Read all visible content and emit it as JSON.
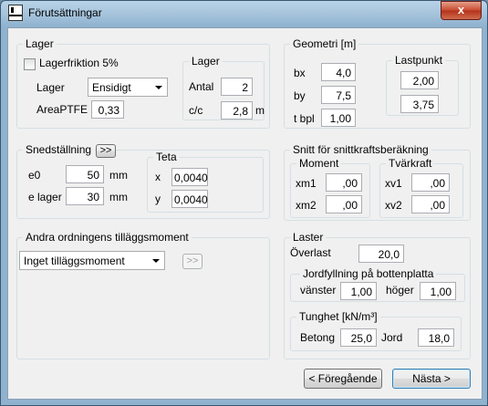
{
  "window": {
    "title": "Förutsättningar",
    "close_label": "x"
  },
  "lager": {
    "title": "Lager",
    "friction_label": "Lagerfriktion 5%",
    "friction_checked": false,
    "type_label": "Lager",
    "type_value": "Ensidigt",
    "area_label": "AreaPTFE",
    "area_value": "0,33",
    "sub": {
      "title": "Lager",
      "antal_label": "Antal",
      "antal_value": "2",
      "cc_label": "c/c",
      "cc_value": "2,8",
      "cc_unit": "m"
    }
  },
  "geometri": {
    "title": "Geometri [m]",
    "bx_label": "bx",
    "bx_value": "4,0",
    "by_label": "by",
    "by_value": "7,5",
    "tbpl_label": "t bpl",
    "tbpl_value": "1,00",
    "lastpunkt": {
      "title": "Lastpunkt",
      "v1": "2,00",
      "v2": "3,75"
    }
  },
  "sned": {
    "title": "Snedställning",
    "button_label": ">>",
    "e0_label": "e0",
    "e0_value": "50",
    "e0_unit": "mm",
    "elager_label": "e lager",
    "elager_value": "30",
    "elager_unit": "mm",
    "teta": {
      "title": "Teta",
      "x_label": "x",
      "x_value": "0,0040",
      "y_label": "y",
      "y_value": "0,0040"
    }
  },
  "snitt": {
    "title": "Snitt för snittkraftsberäkning",
    "moment": {
      "title": "Moment",
      "xm1_label": "xm1",
      "xm1_value": ",00",
      "xm2_label": "xm2",
      "xm2_value": ",00"
    },
    "tvarkraft": {
      "title": "Tvärkraft",
      "xv1_label": "xv1",
      "xv1_value": ",00",
      "xv2_label": "xv2",
      "xv2_value": ",00"
    }
  },
  "andra": {
    "title": "Andra ordningens tilläggsmoment",
    "select_value": "Inget tilläggsmoment",
    "button_label": ">>"
  },
  "laster": {
    "title": "Laster",
    "overlast_label": "Överlast",
    "overlast_value": "20,0",
    "jord": {
      "title": "Jordfyllning på bottenplatta",
      "vanster_label": "vänster",
      "vanster_value": "1,00",
      "hoger_label": "höger",
      "hoger_value": "1,00"
    },
    "tunghet": {
      "title": "Tunghet [kN/m³]",
      "betong_label": "Betong",
      "betong_value": "25,0",
      "jord_label": "Jord",
      "jord_value": "18,0"
    }
  },
  "nav": {
    "prev_label": "< Föregående",
    "next_label": "Nästa >"
  }
}
